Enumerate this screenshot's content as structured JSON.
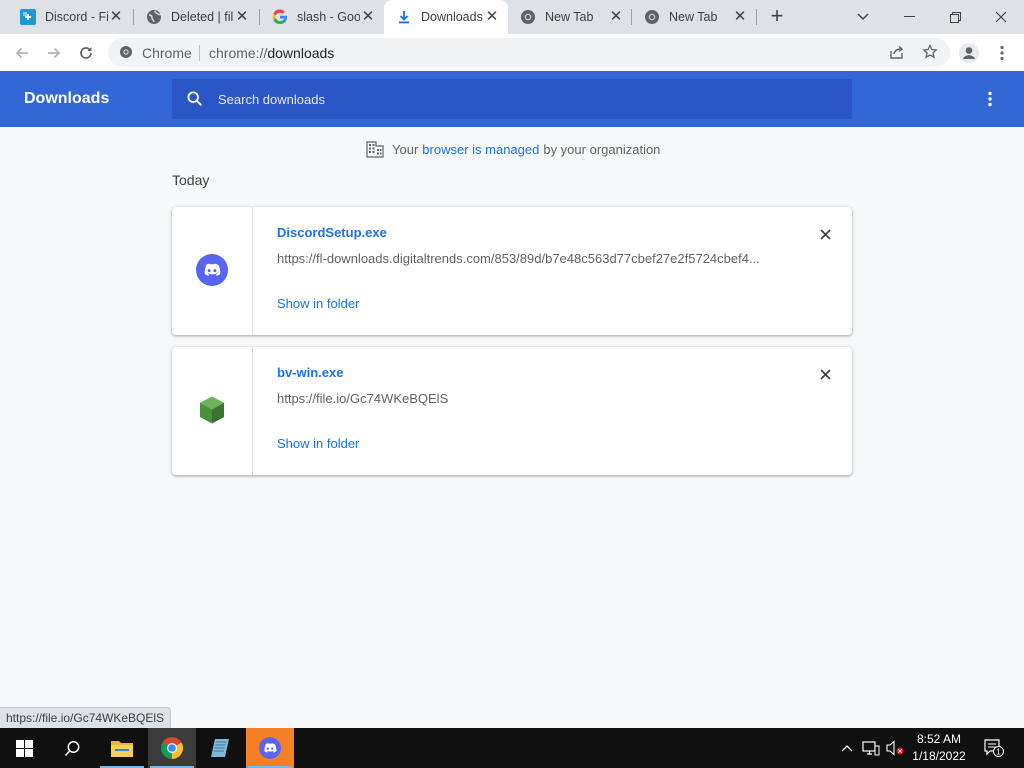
{
  "tabs": [
    {
      "title": "Discord - Fi",
      "favicon": "discord-file-icon",
      "active": false
    },
    {
      "title": "Deleted | fil",
      "favicon": "globe-icon",
      "active": false
    },
    {
      "title": "slash - Goo",
      "favicon": "google-icon",
      "active": false
    },
    {
      "title": "Downloads",
      "favicon": "download-icon",
      "active": true
    },
    {
      "title": "New Tab",
      "favicon": "chrome-icon",
      "active": false
    },
    {
      "title": "New Tab",
      "favicon": "chrome-icon",
      "active": false
    }
  ],
  "omnibox": {
    "site_label": "Chrome",
    "url_scheme": "chrome://",
    "url_host": "downloads"
  },
  "downloads": {
    "title": "Downloads",
    "search_placeholder": "Search downloads",
    "managed_prefix": "Your",
    "managed_link": "browser is managed",
    "managed_suffix": "by your organization",
    "section_label": "Today",
    "items": [
      {
        "filename": "DiscordSetup.exe",
        "url": "https://fl-downloads.digitaltrends.com/853/89d/b7e48c563d77cbef27e2f5724cbef4...",
        "action": "Show in folder",
        "icon": "discord-logo-icon"
      },
      {
        "filename": "bv-win.exe",
        "url": "https://file.io/Gc74WKeBQElS",
        "action": "Show in folder",
        "icon": "green-cube-icon"
      }
    ]
  },
  "status_bar": {
    "text": "https://file.io/Gc74WKeBQElS"
  },
  "taskbar": {
    "time": "8:52 AM",
    "date": "1/18/2022",
    "notification_count": "1"
  },
  "colors": {
    "header_blue": "#3367d6",
    "link_blue": "#1a73e8",
    "discord_blurple": "#5865f2",
    "cube_green": "#4a8f3c"
  }
}
